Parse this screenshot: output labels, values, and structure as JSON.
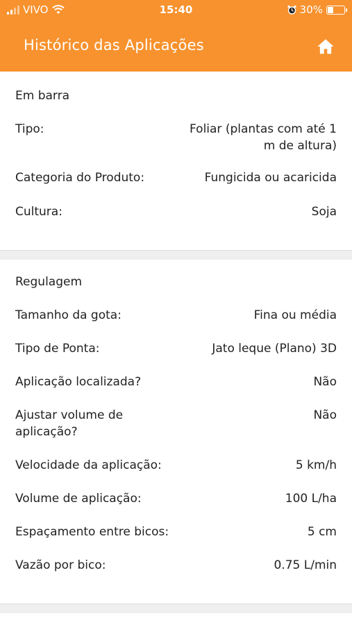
{
  "status_bar": {
    "carrier": "VIVO",
    "time": "15:40",
    "battery_percent": "30%",
    "battery_level": 0.3
  },
  "header": {
    "title": "Histórico das Aplicações",
    "home_icon": "home-icon"
  },
  "sections": [
    {
      "title": "Em barra",
      "rows": [
        {
          "label": "Tipo:",
          "value": "Foliar (plantas com até 1 m de altura)"
        },
        {
          "label": "Categoria do Produto:",
          "value": "Fungicida ou acaricida"
        },
        {
          "label": "Cultura:",
          "value": "Soja"
        }
      ]
    },
    {
      "title": "Regulagem",
      "rows": [
        {
          "label": "Tamanho da gota:",
          "value": "Fina ou média"
        },
        {
          "label": "Tipo de Ponta:",
          "value": "Jato leque (Plano) 3D"
        },
        {
          "label": "Aplicação localizada?",
          "value": "Não"
        },
        {
          "label": "Ajustar volume de aplicação?",
          "value": "Não"
        },
        {
          "label": "Velocidade da aplicação:",
          "value": "5 km/h"
        },
        {
          "label": "Volume de aplicação:",
          "value": "100 L/ha"
        },
        {
          "label": "Espaçamento entre bicos:",
          "value": "5 cm"
        },
        {
          "label": "Vazão por bico:",
          "value": "0.75 L/min"
        }
      ]
    }
  ],
  "colors": {
    "header": "#f7922e",
    "background": "#efefef"
  }
}
